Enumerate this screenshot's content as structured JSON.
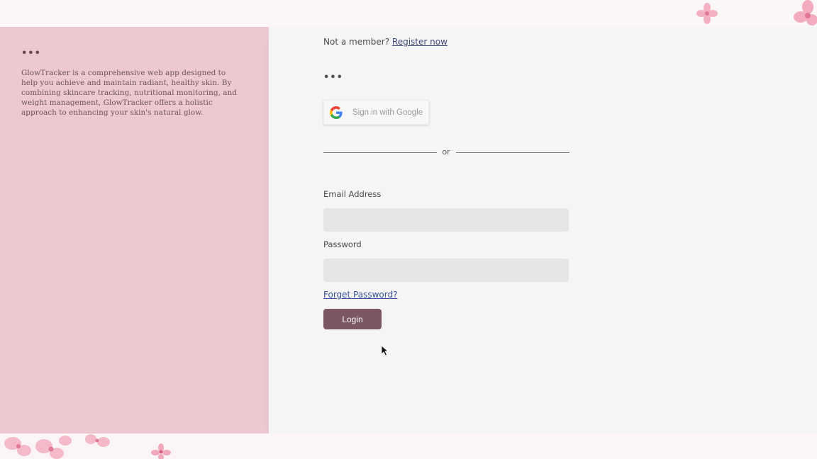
{
  "sidebar": {
    "dots": "•••",
    "description": "GlowTracker is a comprehensive web app designed to help you achieve and maintain radiant, healthy skin. By combining skincare tracking, nutritional monitoring, and weight management, GlowTracker offers a holistic approach to enhancing your skin's natural glow."
  },
  "login": {
    "member_prompt": "Not a member?",
    "register_link": "Register now",
    "dots": "•••",
    "google_button": "Sign in with Google",
    "divider_text": "or",
    "email_label": "Email Address",
    "email_value": "",
    "password_label": "Password",
    "password_value": "",
    "forget_link": "Forget Password?",
    "login_button": "Login"
  },
  "colors": {
    "left_panel": "#eec8d0",
    "right_panel": "#f5f5f5",
    "login_button": "#7c5660",
    "field_background": "#e5e5e5",
    "link": "#3550a0"
  },
  "icons": {
    "google": "google-g-icon",
    "decor": "cherry-blossom-icon",
    "cursor": "mouse-pointer-icon"
  }
}
